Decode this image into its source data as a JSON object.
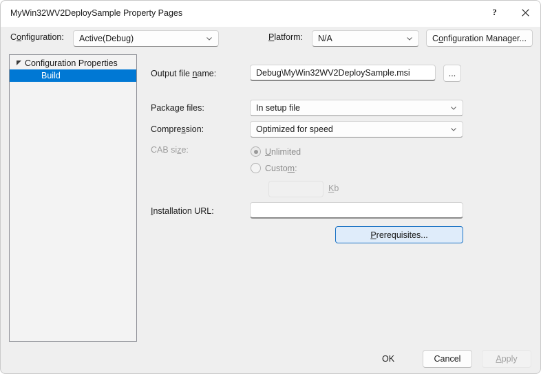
{
  "window": {
    "title": "MyWin32WV2DeploySample Property Pages",
    "help_icon": "question-mark-icon",
    "close_icon": "close-icon"
  },
  "toolbar": {
    "configuration_label_pre": "C",
    "configuration_label_acc": "o",
    "configuration_label_post": "nfiguration:",
    "configuration_value": "Active(Debug)",
    "platform_label_pre": "",
    "platform_label_acc": "P",
    "platform_label_post": "latform:",
    "platform_value": "N/A",
    "config_manager_pre": "C",
    "config_manager_acc": "o",
    "config_manager_post": "nfiguration Manager..."
  },
  "tree": {
    "root_label": "Configuration Properties",
    "child_label": "Build",
    "expander_icon": "triangle-expanded-icon"
  },
  "form": {
    "output_file_pre": "Output file ",
    "output_file_acc": "n",
    "output_file_post": "ame:",
    "output_file_value": "Debug\\MyWin32WV2DeploySample.msi",
    "browse_label": "...",
    "package_files_pre": "Packa",
    "package_files_acc": "g",
    "package_files_post": "e files:",
    "package_files_value": "In setup file",
    "compression_pre": "Compre",
    "compression_acc": "s",
    "compression_post": "sion:",
    "compression_value": "Optimized for speed",
    "cab_size_pre": "CAB si",
    "cab_size_acc": "z",
    "cab_size_post": "e:",
    "unlimited_pre": "",
    "unlimited_acc": "U",
    "unlimited_post": "nlimited",
    "custom_pre": "Custo",
    "custom_acc": "m",
    "custom_post": ":",
    "cab_custom_value": "",
    "kb_acc": "K",
    "kb_post": "b",
    "installation_url_pre": "",
    "installation_url_acc": "I",
    "installation_url_post": "nstallation URL:",
    "installation_url_value": "",
    "prerequisites_pre": "",
    "prerequisites_acc": "P",
    "prerequisites_post": "rerequisites..."
  },
  "footer": {
    "ok_label": "OK",
    "cancel_label": "Cancel",
    "apply_pre": "",
    "apply_acc": "A",
    "apply_post": "pply"
  },
  "colors": {
    "accent": "#0078d4",
    "dialog_bg": "#efefef",
    "selection_bg": "#0078d4",
    "disabled_text": "#a0a0a0"
  }
}
